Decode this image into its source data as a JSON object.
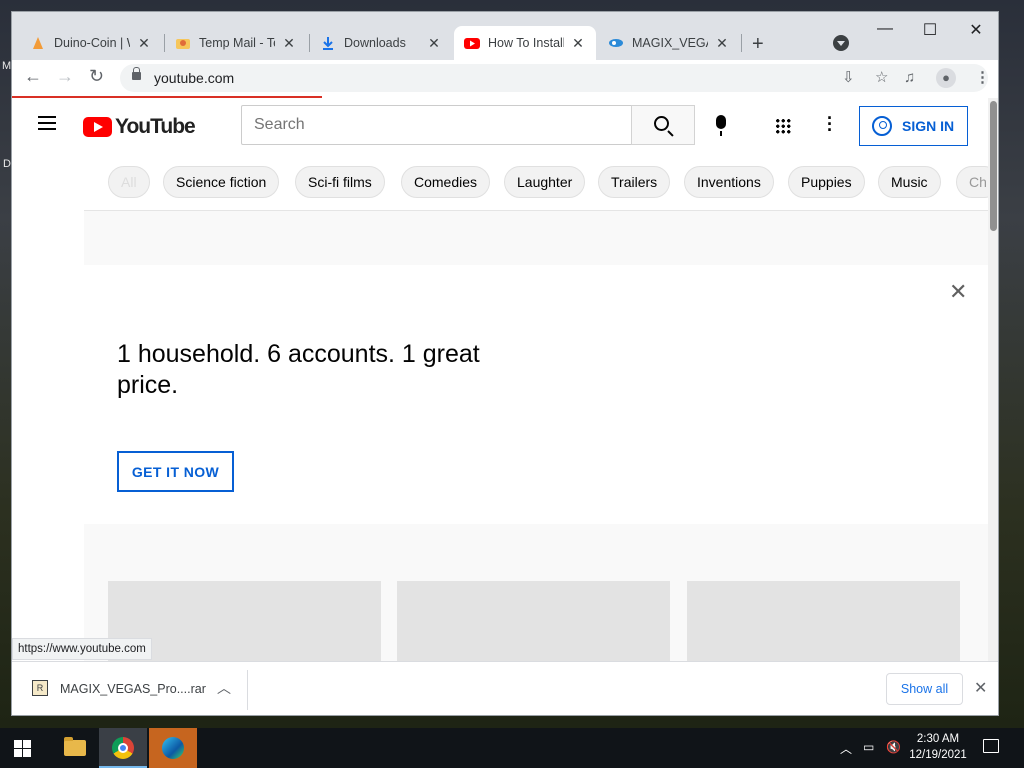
{
  "tabs": [
    {
      "label": "Duino-Coin | W",
      "icon": "duino-icon",
      "active": false
    },
    {
      "label": "Temp Mail - Te",
      "icon": "tempmail-icon",
      "active": false
    },
    {
      "label": "Downloads",
      "icon": "download-icon",
      "active": false
    },
    {
      "label": "How To Install",
      "icon": "youtube-icon",
      "active": true
    },
    {
      "label": "MAGIX_VEGAS",
      "icon": "magix-icon",
      "active": false
    }
  ],
  "omnibox": {
    "url": "youtube.com"
  },
  "youtube": {
    "logo_text": "YouTube",
    "search_placeholder": "Search",
    "sign_in_label": "SIGN IN",
    "chips": [
      "All",
      "Science fiction",
      "Sci-fi films",
      "Comedies",
      "Laughter",
      "Trailers",
      "Inventions",
      "Puppies",
      "Music",
      "Ch"
    ]
  },
  "promo": {
    "headline": "1 household. 6 accounts. 1 great price.",
    "button_label": "GET IT NOW"
  },
  "status_url": "https://www.youtube.com",
  "download_bar": {
    "file_name": "MAGIX_VEGAS_Pro....rar",
    "show_all_label": "Show all"
  },
  "taskbar": {
    "time": "2:30 AM",
    "date": "12/19/2021"
  },
  "desktop_letters": [
    "M",
    "D"
  ],
  "colors": {
    "youtube_red": "#ff0000",
    "link_blue": "#065fd4",
    "loading_red": "#d93025"
  }
}
